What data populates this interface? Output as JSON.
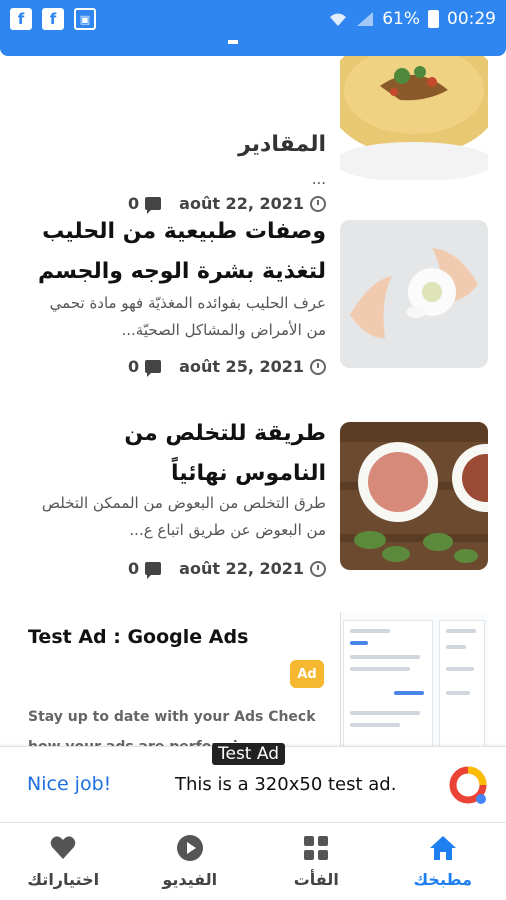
{
  "status_bar": {
    "battery": "61%",
    "time": "00:29",
    "icons": [
      "facebook-icon",
      "facebook-icon",
      "image-icon",
      "wifi-icon",
      "signal-icon",
      "battery-icon"
    ]
  },
  "articles": [
    {
      "title": "المقادير",
      "excerpt": "...",
      "date": "août 22, 2021",
      "comments": "0",
      "thumb": "soup-thumbnail"
    },
    {
      "title": "وصفات طبيعية من الحليب لتغذية بشرة الوجه والجسم",
      "excerpt": "عرف الحليب بفوائده المغذيّة فهو مادة تحمي من الأمراض والمشاكل الصحيّة...",
      "date": "août 25, 2021",
      "comments": "0",
      "thumb": "milk-flower-thumbnail"
    },
    {
      "title": "طريقة للتخلص من الناموس نهائياً",
      "excerpt": "طرق التخلص من البعوض من الممكن التخلص من البعوض عن طريق اتباع ع...",
      "date": "août 22, 2021",
      "comments": "0",
      "thumb": "tea-cups-thumbnail"
    }
  ],
  "ad_card": {
    "title": "Test Ad : Google Ads",
    "badge": "Ad",
    "body": "Stay up to date with your Ads Check how your ads are performing"
  },
  "banner": {
    "label": "Test Ad",
    "nice": "Nice job!",
    "text": "This is a 320x50 test ad."
  },
  "bottom_nav": {
    "items": [
      {
        "label": "اختياراتك",
        "icon": "heart-icon"
      },
      {
        "label": "الفيديو",
        "icon": "play-icon"
      },
      {
        "label": "الفأت",
        "icon": "grid-icon"
      },
      {
        "label": "مطبخك",
        "icon": "home-icon"
      }
    ],
    "active": "مطبخك"
  },
  "colors": {
    "primary": "#2f86f0",
    "active_nav": "#1e7ff0",
    "ad_badge": "#f6b731"
  }
}
